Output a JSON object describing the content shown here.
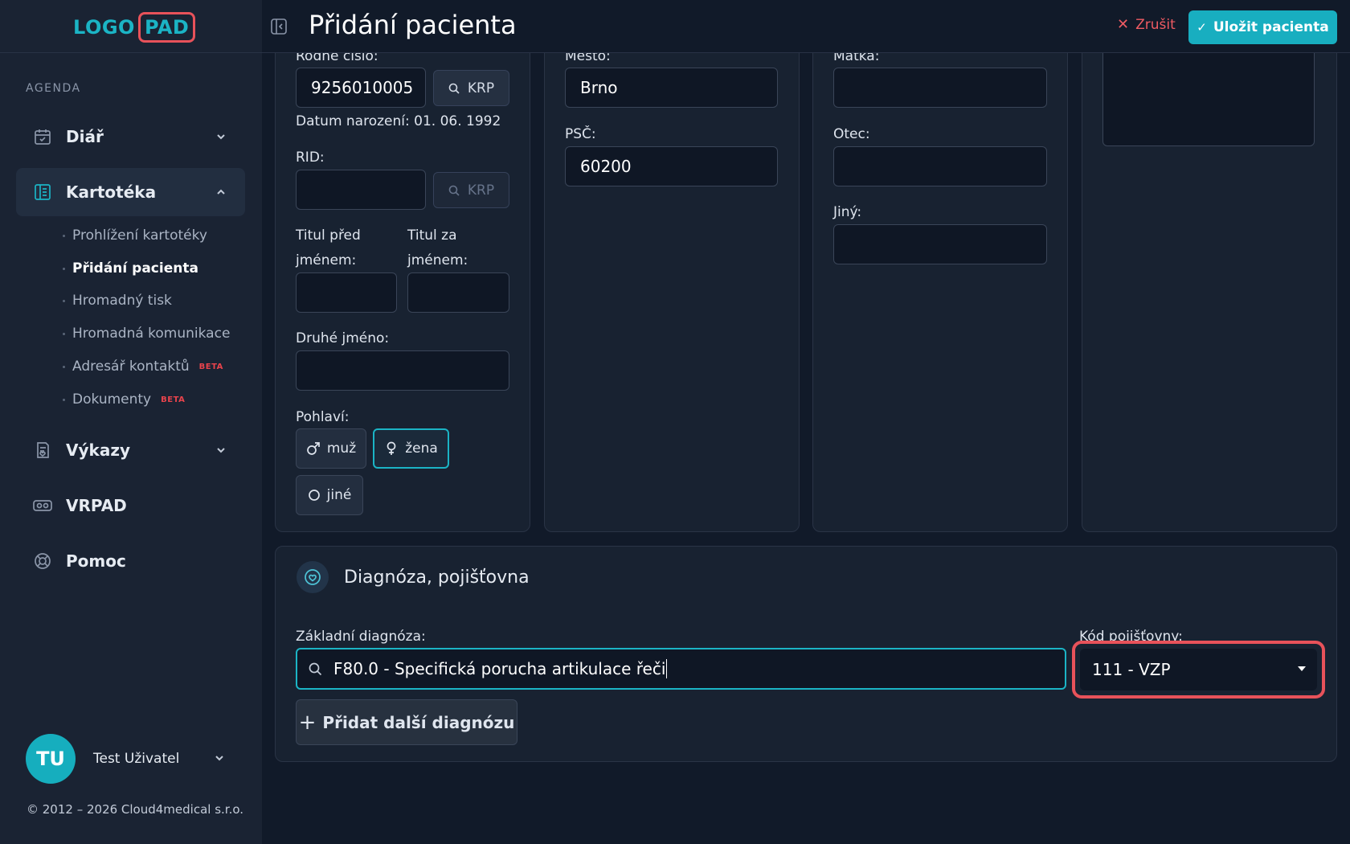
{
  "logo": {
    "part1": "LOGO",
    "part2": "PAD"
  },
  "sidebar": {
    "section_label": "AGENDA",
    "nav": [
      {
        "label": "Diář",
        "icon": "calendar-check-icon"
      },
      {
        "label": "Kartotéka",
        "icon": "book-icon"
      },
      {
        "label": "Výkazy",
        "icon": "report-icon"
      },
      {
        "label": "VRPAD",
        "icon": "vr-headset-icon"
      },
      {
        "label": "Pomoc",
        "icon": "lifebuoy-icon"
      }
    ],
    "sub_items": [
      {
        "label": "Prohlížení kartotéky"
      },
      {
        "label": "Přidání pacienta"
      },
      {
        "label": "Hromadný tisk"
      },
      {
        "label": "Hromadná komunikace"
      },
      {
        "label": "Adresář kontaktů",
        "badge": "BETA"
      },
      {
        "label": "Dokumenty",
        "badge": "BETA"
      }
    ],
    "user": {
      "initials": "TU",
      "name": "Test Uživatel"
    },
    "copyright": "© 2012 – 2026 Cloud4medical s.r.o."
  },
  "header": {
    "title": "Přidání pacienta",
    "cancel_label": "Zrušit",
    "save_label": "Uložit pacienta"
  },
  "form": {
    "rodne_cislo": {
      "label": "Rodné číslo:",
      "value": "9256010005",
      "krp": "KRP"
    },
    "datum_narozeni": "Datum narození: 01. 06. 1992",
    "rid": {
      "label": "RID:",
      "value": "",
      "krp": "KRP"
    },
    "titul_pred": {
      "label_line1": "Titul před",
      "label_line2": "jménem:",
      "value": ""
    },
    "titul_za": {
      "label_line1": "Titul za",
      "label_line2": "jménem:",
      "value": ""
    },
    "druhe_jmeno": {
      "label": "Druhé jméno:",
      "value": ""
    },
    "pohlavi": {
      "label": "Pohlaví:",
      "options": [
        {
          "label": "muž",
          "selected": false
        },
        {
          "label": "žena",
          "selected": true
        },
        {
          "label": "jiné",
          "selected": false
        }
      ]
    },
    "mesto": {
      "label": "Město:",
      "value": "Brno"
    },
    "psc": {
      "label": "PSČ:",
      "value": "60200"
    },
    "matka": {
      "label": "Matka:",
      "value": ""
    },
    "otec": {
      "label": "Otec:",
      "value": ""
    },
    "jiny": {
      "label": "Jiný:",
      "value": ""
    }
  },
  "diagnosis": {
    "section_title": "Diagnóza, pojišťovna",
    "base_label": "Základní diagnóza:",
    "base_value": "F80.0 - Specifická porucha artikulace řeči",
    "insurance_label": "Kód pojišťovny:",
    "insurance_value": "111 - VZP",
    "add_button": "Přidat další diagnózu"
  },
  "colors": {
    "accent": "#1bb4c5",
    "danger": "#e8525a",
    "bg": "#111a29",
    "sidebar": "#1a2333"
  }
}
